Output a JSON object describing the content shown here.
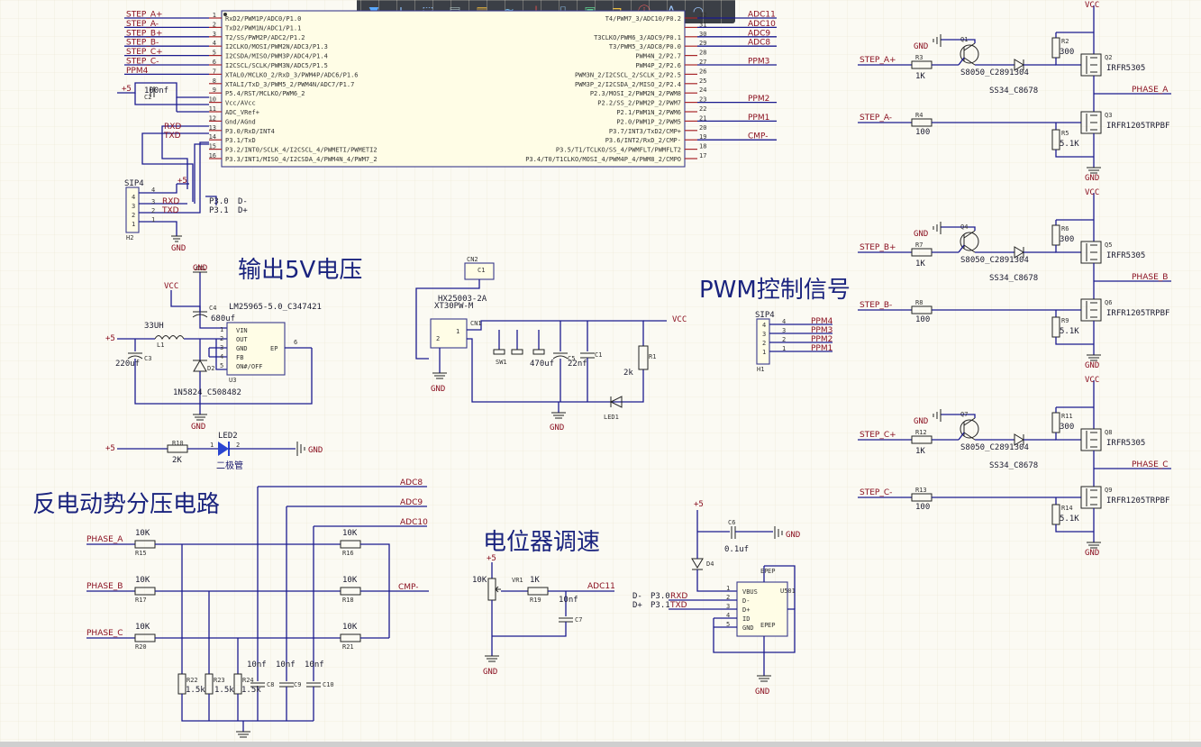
{
  "toolbar": {
    "tools": [
      {
        "id": "filter",
        "glyph": "▼",
        "color": "#5aa9ff"
      },
      {
        "id": "add",
        "glyph": "+",
        "color": "#8fc1ff"
      },
      {
        "id": "rect-select",
        "glyph": "⬚",
        "color": "#8fc1ff"
      },
      {
        "id": "align",
        "glyph": "▤",
        "color": "#9aa"
      },
      {
        "id": "component",
        "glyph": "▥",
        "color": "#e0b040"
      },
      {
        "id": "net",
        "glyph": "≈",
        "color": "#7fd0ff"
      },
      {
        "id": "ground",
        "glyph": "⏚",
        "color": "#e05050"
      },
      {
        "id": "bus",
        "glyph": "⌷",
        "color": "#9ad0ff"
      },
      {
        "id": "sheet",
        "glyph": "▣",
        "color": "#60d090"
      },
      {
        "id": "port",
        "glyph": "⊐",
        "color": "#f0c040"
      },
      {
        "id": "directive",
        "glyph": "ⓘ",
        "color": "#ff6060"
      },
      {
        "id": "text",
        "glyph": "A",
        "color": "#9fc8ff"
      },
      {
        "id": "arc",
        "glyph": "◠",
        "color": "#9fc8ff"
      }
    ]
  },
  "headings": {
    "output5v": "输出5V电压",
    "pwm": "PWM控制信号",
    "bemf": "反电动势分压电路",
    "pot": "电位器调速"
  },
  "mcu": {
    "left_pins": [
      {
        "n": "1",
        "name": "RxD2/PWM1P/ADC0/P1.0",
        "net": "STEP_A+"
      },
      {
        "n": "2",
        "name": "TxD2/PWM1N/ADC1/P1.1",
        "net": "STEP_A-"
      },
      {
        "n": "3",
        "name": "T2/SS/PWM2P/ADC2/P1.2",
        "net": "STEP_B+"
      },
      {
        "n": "4",
        "name": "I2CLKO/MOSI/PWM2N/ADC3/P1.3",
        "net": "STEP_B-"
      },
      {
        "n": "5",
        "name": "I2CSDA/MISO/PWM3P/ADC4/P1.4",
        "net": "STEP_C+"
      },
      {
        "n": "6",
        "name": "I2CSCL/SCLK/PWM3N/ADC5/P1.5",
        "net": "STEP_C-"
      },
      {
        "n": "7",
        "name": "XTAL0/MCLKO_2/RxD_3/PWM4P/ADC6/P1.6",
        "net": "PPM4"
      },
      {
        "n": "8",
        "name": "XTALI/TxD_3/PWM5_2/PWM4N/ADC7/P1.7",
        "net": ""
      },
      {
        "n": "9",
        "name": "P5.4/RST/MCLKO/PWM6_2",
        "net": ""
      },
      {
        "n": "10",
        "name": "Vcc/AVcc",
        "net": ""
      },
      {
        "n": "11",
        "name": "ADC_VRef+",
        "net": ""
      },
      {
        "n": "12",
        "name": "Gnd/AGnd",
        "net": ""
      },
      {
        "n": "13",
        "name": "P3.0/RxD/INT4",
        "net": "RXD"
      },
      {
        "n": "14",
        "name": "P3.1/TxD",
        "net": "TXD"
      },
      {
        "n": "15",
        "name": "P3.2/INT0/SCLK_4/I2CSCL_4/PWMETI/PWMETI2",
        "net": ""
      },
      {
        "n": "16",
        "name": "P3.3/INT1/MISO_4/I2CSDA_4/PWM4N_4/PWM7_2",
        "net": ""
      }
    ],
    "right_pins": [
      {
        "n": "32",
        "name": "T4/PWM7_3/ADC10/P0.2",
        "net": "ADC11"
      },
      {
        "n": "31",
        "name": "",
        "net": "ADC10"
      },
      {
        "n": "30",
        "name": "T3CLKO/PWM6_3/ADC9/P0.1",
        "net": "ADC9"
      },
      {
        "n": "29",
        "name": "T3/PWM5_3/ADC8/P0.0",
        "net": "ADC8"
      },
      {
        "n": "28",
        "name": "PWM4N_2/P2.7",
        "net": ""
      },
      {
        "n": "27",
        "name": "PWM4P_2/P2.6",
        "net": "PPM3"
      },
      {
        "n": "26",
        "name": "PWM3N_2/I2CSCL_2/SCLK_2/P2.5",
        "net": ""
      },
      {
        "n": "25",
        "name": "PWM3P_2/I2CSDA_2/MISO_2/P2.4",
        "net": ""
      },
      {
        "n": "24",
        "name": "P2.3/MOSI_2/PWM2N_2/PWM8",
        "net": ""
      },
      {
        "n": "23",
        "name": "P2.2/SS_2/PWM2P_2/PWM7",
        "net": "PPM2"
      },
      {
        "n": "22",
        "name": "P2.1/PWM1N_2/PWM6",
        "net": ""
      },
      {
        "n": "21",
        "name": "P2.0/PWM1P_2/PWM5",
        "net": "PPM1"
      },
      {
        "n": "20",
        "name": "P3.7/INT3/TxD2/CMP+",
        "net": ""
      },
      {
        "n": "19",
        "name": "P3.6/INT2/RxD_2/CMP-",
        "net": "CMP-"
      },
      {
        "n": "18",
        "name": "P3.5/T1/TCLKO/SS_4/PWMFLT/PWMFLT2",
        "net": ""
      },
      {
        "n": "17",
        "name": "P3.4/T0/T1CLKO/MOSI_4/PWM4P_4/PWM8_2/CMPO",
        "net": ""
      }
    ]
  },
  "labels": {
    "plus5": "+5",
    "gnd": "GND",
    "vcc": "VCC",
    "c100nf": "100nf",
    "c2": "C2",
    "rxd": "RXD",
    "txd": "TXD",
    "sip4": "SIP4",
    "h2": "H2",
    "h1": "H1",
    "p30": "P3.0",
    "p31": "P3.1",
    "dminus": "D-",
    "dplus": "D+",
    "lm": "LM25965-5.0_C347421",
    "u3": "U3",
    "l33uh": "33UH",
    "l1": "L1",
    "c220uf": "220uf",
    "c680uf": "680uf",
    "c4": "C4",
    "c3": "C3",
    "d1n": "1N5824_C508482",
    "d2": "D2",
    "u3pins": [
      "VIN",
      "OUT",
      "GND",
      "FB",
      "ON#/OFF",
      "EP"
    ],
    "u3nums": [
      "1",
      "2",
      "3",
      "4",
      "5",
      "6"
    ],
    "led2": "LED2",
    "r10": "R10",
    "r2k": "2K",
    "erjiguan": "二极管",
    "cn2": "CN2",
    "c1": "C1",
    "hx": "HX25003-2A",
    "xt": "XT30PW-M",
    "cn1": "CN1",
    "sw1": "SW1",
    "c470uf": "470uf",
    "c22nf": "22nf",
    "c5": "C5",
    "c1b": "C1",
    "r2kk": "2k",
    "r1": "R1",
    "led1": "LED1",
    "ppm": [
      "PPM4",
      "PPM3",
      "PPM2",
      "PPM1"
    ],
    "sipnums": [
      "4",
      "3",
      "2",
      "1"
    ],
    "phaseA": "PHASE_A",
    "phaseB": "PHASE_B",
    "phaseC": "PHASE_C",
    "r10k": "10K",
    "r15k": "1.5k",
    "c10nf": "10nf",
    "rlabels": [
      "R15",
      "R17",
      "R20",
      "R16",
      "R18",
      "R21",
      "R22",
      "R23",
      "R24",
      "C8",
      "C9",
      "C10"
    ],
    "adc8": "ADC8",
    "adc9": "ADC9",
    "adc10": "ADC10",
    "adc11": "ADC11",
    "cmp": "CMP-",
    "vr1": "VR1",
    "r19": "R19",
    "r1k": "1K",
    "c7": "C7",
    "c6": "C6",
    "c01uf": "0.1uf",
    "d4": "D4",
    "u501": "U501",
    "usbpins": [
      "VBUS",
      "D-",
      "D+",
      "ID",
      "GND"
    ],
    "usbnums": [
      "1",
      "2",
      "3",
      "4",
      "5"
    ],
    "usbep": [
      "EP",
      "EP",
      "EP",
      "EP"
    ],
    "q1": "Q1",
    "q4": "Q4",
    "q7": "Q7",
    "q2": "Q2",
    "q3": "Q3",
    "q5": "Q5",
    "q6": "Q6",
    "q8": "Q8",
    "q9": "Q9",
    "s8050": "S8050_C2891304",
    "ss34": "SS34_C8678",
    "irfr5305": "IRFR5305",
    "irfr1205": "IRFR1205TRPBF",
    "r300": "300",
    "r100": "100",
    "r51k": "5.1K",
    "r1k_": "1K",
    "stepAp": "STEP_A+",
    "stepAm": "STEP_A-",
    "stepBp": "STEP_B+",
    "stepBm": "STEP_B-",
    "stepCp": "STEP_C+",
    "stepCm": "STEP_C-",
    "r3": "R3",
    "r4": "R4",
    "r2r": "R2",
    "r5": "R5",
    "r6": "R6",
    "r7": "R7",
    "r8": "R8",
    "r9": "R9",
    "r11": "R11",
    "r12": "R12",
    "r13": "R13",
    "r14": "R14"
  }
}
